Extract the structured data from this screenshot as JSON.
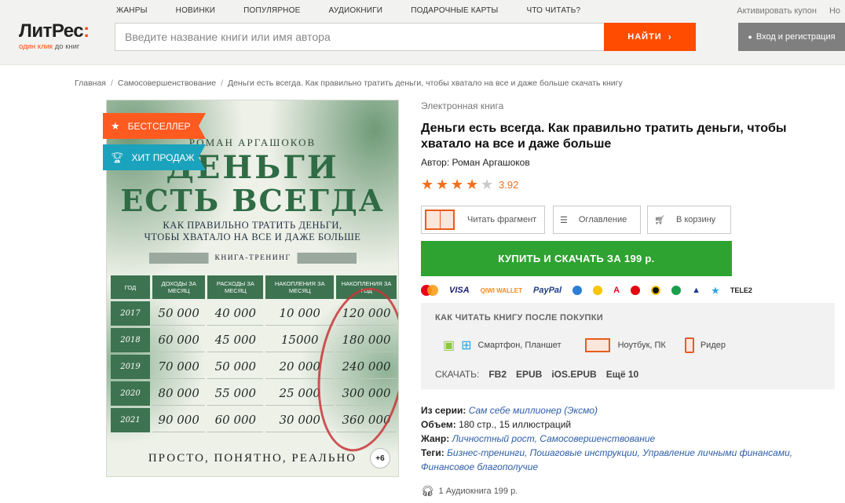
{
  "header": {
    "logo_main_a": "Лит",
    "logo_main_b": "Рес",
    "logo_main_c": ":",
    "logo_sub_a": "один клик",
    "logo_sub_b": " до книг",
    "nav": [
      "ЖАНРЫ",
      "НОВИНКИ",
      "ПОПУЛЯРНОЕ",
      "АУДИОКНИГИ",
      "ПОДАРОЧНЫЕ КАРТЫ",
      "ЧТО ЧИТАТЬ?"
    ],
    "top_links": [
      "Активировать купон",
      "Но"
    ],
    "search_placeholder": "Введите название книги или имя автора",
    "search_button": "НАЙТИ",
    "login_button": "Вход и регистрация"
  },
  "breadcrumb": [
    "Главная",
    "Самосовершенствование",
    "Деньги есть всегда. Как правильно тратить деньги, чтобы хватало на все и даже больше скачать книгу"
  ],
  "cover": {
    "badge_best": "БЕСТСЕЛЛЕР",
    "badge_hit": "ХИТ ПРОДАЖ",
    "author": "РОМАН АРГАШОКОВ",
    "title1": "ДЕНЬГИ",
    "title2": "ЕСТЬ ВСЕГДА",
    "subtitle1": "КАК ПРАВИЛЬНО ТРАТИТЬ ДЕНЬГИ,",
    "subtitle2": "ЧТОБЫ ХВАТАЛО НА ВСЕ И ДАЖЕ БОЛЬШЕ",
    "ribbon": "КНИГА-ТРЕНИНГ",
    "table_headers": [
      "ГОД",
      "ДОХОДЫ ЗА МЕСЯЦ",
      "РАСХОДЫ ЗА МЕСЯЦ",
      "НАКОПЛЕНИЯ ЗА МЕСЯЦ",
      "НАКОПЛЕНИЯ ЗА ГОД"
    ],
    "table_rows": [
      [
        "2017",
        "50 000",
        "40 000",
        "10 000",
        "120 000"
      ],
      [
        "2018",
        "60 000",
        "45 000",
        "15000",
        "180 000"
      ],
      [
        "2019",
        "70 000",
        "50 000",
        "20 000",
        "240 000"
      ],
      [
        "2020",
        "80 000",
        "55 000",
        "25 000",
        "300 000"
      ],
      [
        "2021",
        "90 000",
        "60 000",
        "30 000",
        "360 000"
      ]
    ],
    "bottom": "ПРОСТО, ПОНЯТНО, РЕАЛЬНО",
    "more": "+6"
  },
  "book": {
    "kind": "Электронная книга",
    "title": "Деньги есть всегда. Как правильно тратить деньги, чтобы хватало на все и даже больше",
    "author_label": "Автор: ",
    "author": "Роман Аргашоков",
    "rating_value": "3.92",
    "rating_stars": 4
  },
  "actions": {
    "read": "Читать фрагмент",
    "toc": "Оглавление",
    "cart": "В корзину",
    "buy": "КУПИТЬ И СКАЧАТЬ ЗА 199 р."
  },
  "payments": [
    "VISA",
    "QIWI WALLET",
    "PayPal",
    "TELE2"
  ],
  "colors": {
    "accent": "#ff4c00",
    "buy": "#2fa332",
    "hit": "#1ba3bd",
    "link": "#2d5ea8",
    "star": "#f36e1b"
  },
  "how_to_read": {
    "title": "КАК ЧИТАТЬ КНИГУ ПОСЛЕ ПОКУПКИ",
    "phone": "Смартфон, Планшет",
    "laptop": "Ноутбук, ПК",
    "reader": "Ридер",
    "download_label": "СКАЧАТЬ:",
    "formats": [
      "FB2",
      "EPUB",
      "iOS.EPUB",
      "Ещё 10"
    ]
  },
  "meta": {
    "series_label": "Из серии: ",
    "series": "Сам себе миллионер (Эксмо)",
    "volume_label": "Объем: ",
    "volume": "180 стр., 15 иллюстраций",
    "genre_label": "Жанр: ",
    "genre": "Личностный рост, Самосовершенствование",
    "tags_label": "Теги: ",
    "tags": "Бизнес-тренинги, Пошаговые инструкции, Управление личными финансами,",
    "tags2": "Финансовое благополучие"
  },
  "audio": "1 Аудиокнига 199 р."
}
